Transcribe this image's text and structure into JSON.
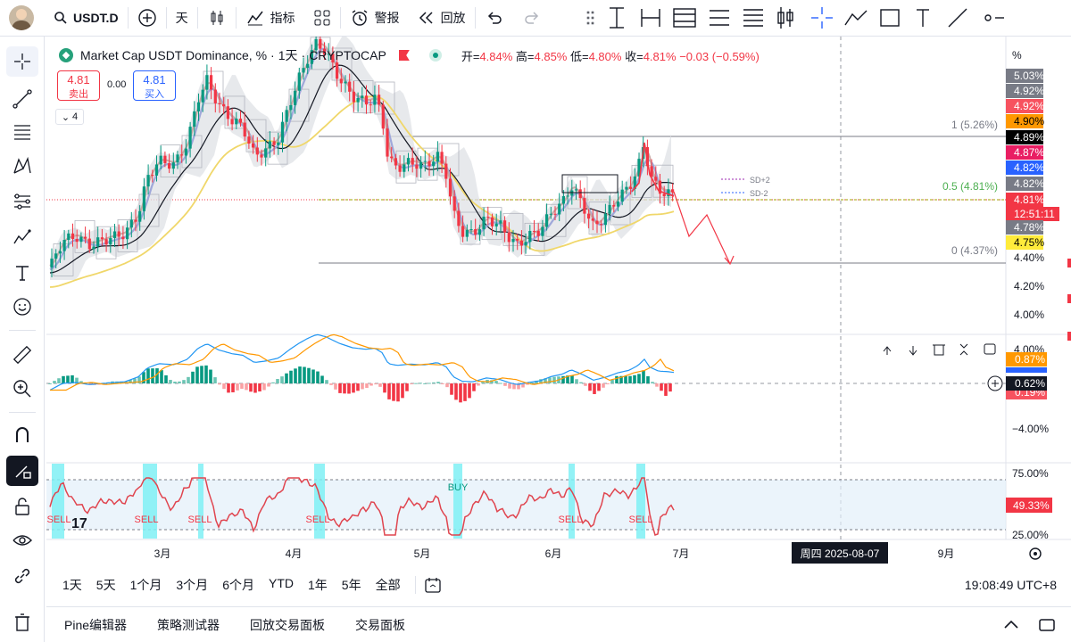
{
  "topbar": {
    "symbol": "USDT.D",
    "interval": "天",
    "indicators": "指标",
    "alert": "警报",
    "replay": "回放"
  },
  "legend": {
    "title": "Market Cap USDT Dominance, %",
    "interval": "1天",
    "source": "CRYPTOCAP",
    "open_label": "开=",
    "open": "4.84%",
    "high_label": "高=",
    "high": "4.85%",
    "low_label": "低=",
    "low": "4.80%",
    "close_label": "收=",
    "close": "4.81%",
    "change": "−0.03 (−0.59%)"
  },
  "trade": {
    "sell_price": "4.81",
    "sell_label": "卖出",
    "spread": "0.00",
    "buy_price": "4.81",
    "buy_label": "买入",
    "collapse": "4"
  },
  "price_axis": {
    "unit": "%",
    "ticks": [
      "4.40%",
      "4.20%",
      "4.00%"
    ],
    "tags": [
      {
        "text": "5.03%",
        "bg": "#787b86",
        "fg": "#ffffff"
      },
      {
        "text": "4.92%",
        "bg": "#787b86",
        "fg": "#ffffff"
      },
      {
        "text": "4.92%",
        "bg": "#f7525f",
        "fg": "#ffffff"
      },
      {
        "text": "4.90%",
        "bg": "#ff9800",
        "fg": "#000000"
      },
      {
        "text": "4.89%",
        "bg": "#000000",
        "fg": "#ffffff"
      },
      {
        "text": "4.87%",
        "bg": "#e91e63",
        "fg": "#ffffff"
      },
      {
        "text": "4.82%",
        "bg": "#2962ff",
        "fg": "#ffffff"
      },
      {
        "text": "4.82%",
        "bg": "#787b86",
        "fg": "#ffffff"
      },
      {
        "text": "4.81%",
        "bg": "#f23645",
        "fg": "#ffffff"
      },
      {
        "text": "12:51:11",
        "bg": "#f23645",
        "fg": "#ffffff"
      },
      {
        "text": "4.78%",
        "bg": "#787b86",
        "fg": "#ffffff"
      },
      {
        "text": "4.75%",
        "bg": "#ffeb3b",
        "fg": "#000000"
      }
    ]
  },
  "fib": {
    "l1": "1 (5.26%)",
    "l05": "0.5 (4.81%)",
    "l0": "0 (4.37%)"
  },
  "sd": {
    "plus": "SD+2",
    "minus": "SD-2"
  },
  "macd_axis": {
    "tick_top": "4.00%",
    "tick_bottom": "−4.00%",
    "tag1": "0.87%",
    "tag2": "0.62%",
    "tag3": "0.19%"
  },
  "rsi_axis": {
    "tick_top": "75.00%",
    "tick_bottom": "25.00%",
    "tag": "49.33%"
  },
  "signals": {
    "sell": "SELL",
    "buy": "BUY"
  },
  "time_axis": {
    "labels": [
      "3月",
      "4月",
      "5月",
      "6月",
      "7月",
      "9月"
    ],
    "crosshair": "周四 2025-08-07"
  },
  "ranges": [
    "1天",
    "5天",
    "1个月",
    "3个月",
    "6个月",
    "YTD",
    "1年",
    "5年",
    "全部"
  ],
  "clock": "19:08:49 UTC+8",
  "footer": {
    "tabs": [
      "Pine编辑器",
      "策略测试器",
      "回放交易面板",
      "交易面板"
    ]
  },
  "colors": {
    "up": "#089981",
    "down": "#f23645",
    "accent": "#2962ff"
  }
}
